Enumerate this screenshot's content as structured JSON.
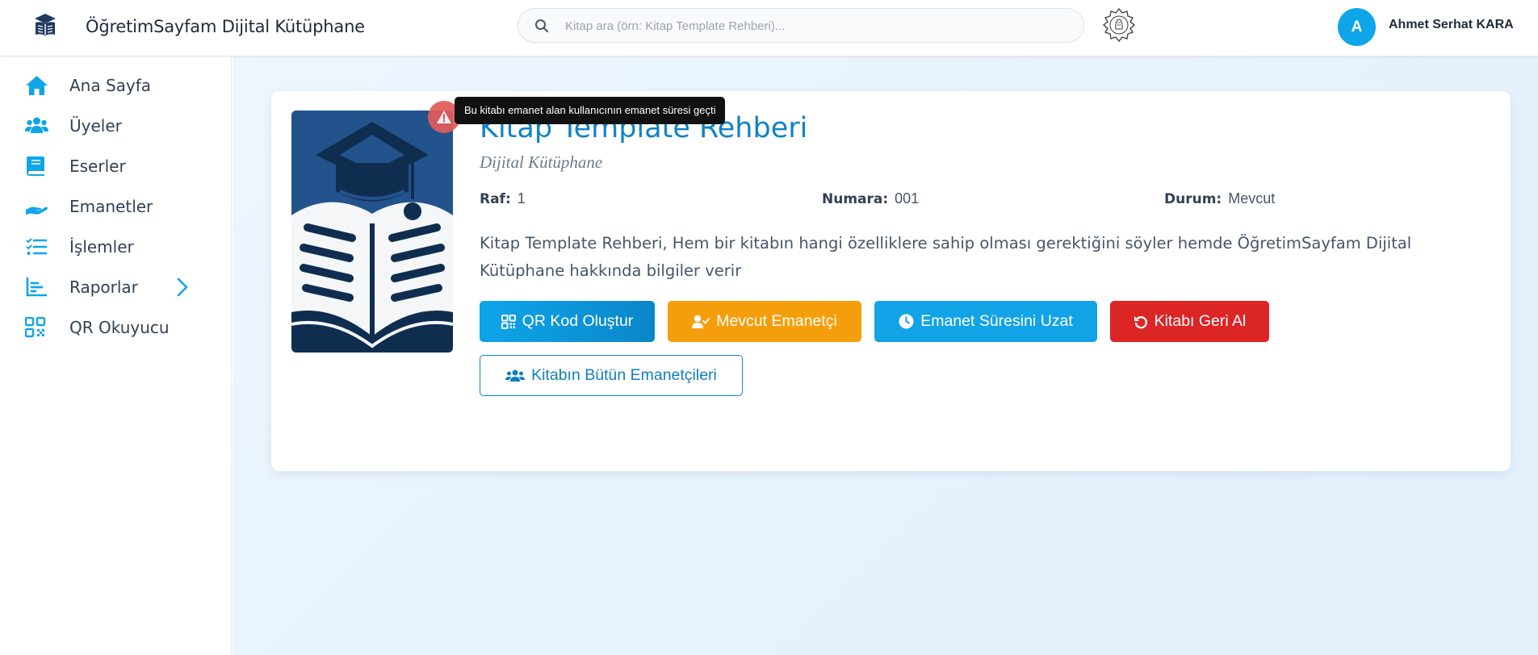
{
  "header": {
    "app_title": "ÖğretimSayfam Dijital Kütüphane",
    "search_placeholder": "Kitap ara (örn: Kitap Template Rehberi)...",
    "user": {
      "initial": "A",
      "name": "Ahmet Serhat KARA"
    }
  },
  "sidebar": {
    "items": [
      {
        "label": "Ana Sayfa",
        "icon": "home-icon"
      },
      {
        "label": "Üyeler",
        "icon": "users-icon"
      },
      {
        "label": "Eserler",
        "icon": "book-icon"
      },
      {
        "label": "Emanetler",
        "icon": "hand-icon"
      },
      {
        "label": "İşlemler",
        "icon": "list-check-icon"
      },
      {
        "label": "Raporlar",
        "icon": "chart-icon",
        "has_chevron": true
      },
      {
        "label": "QR Okuyucu",
        "icon": "qr-icon"
      }
    ]
  },
  "book": {
    "title": "Kitap Template Rehberi",
    "subtitle": "Dijital Kütüphane",
    "meta": {
      "shelf_label": "Raf:",
      "shelf_value": "1",
      "number_label": "Numara:",
      "number_value": "001",
      "status_label": "Durum:",
      "status_value": "Mevcut"
    },
    "description": "Kitap Template Rehberi, Hem bir kitabın hangi özelliklere sahip olması gerektiğini söyler hemde ÖğretimSayfam Dijital Kütüphane hakkında bilgiler verir",
    "warning_tooltip": "Bu kitabı emanet alan kullanıcının emanet süresi geçti"
  },
  "actions": {
    "qr": "QR Kod Oluştur",
    "current_borrower": "Mevcut Emanetçi",
    "extend": "Emanet Süresini Uzat",
    "return": "Kitabı Geri Al",
    "all_borrowers": "Kitabın Bütün Emanetçileri"
  },
  "colors": {
    "accent": "#0ea5e9",
    "title": "#0f83c7",
    "warning": "#f59e0b",
    "danger": "#dc2626",
    "cover_bg": "#23538c"
  }
}
